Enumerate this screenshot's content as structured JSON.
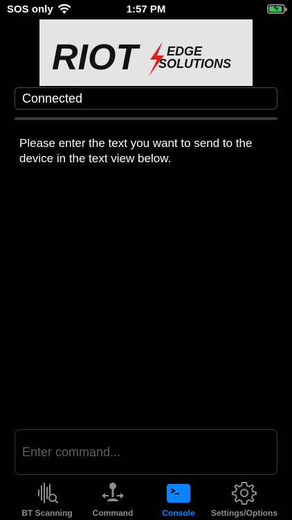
{
  "status_bar": {
    "carrier": "SOS only",
    "time": "1:57 PM",
    "battery_level": 0.9
  },
  "logo": {
    "brand": "RIOT",
    "tagline_line1": "EDGE",
    "tagline_line2": "SOLUTIONS"
  },
  "connection": {
    "status": "Connected"
  },
  "instructions": "Please enter the text you want to send to the device in the text view below.",
  "command_input": {
    "value": "",
    "placeholder": "Enter command..."
  },
  "tabs": [
    {
      "label": "BT Scanning",
      "icon": "waveform-search-icon",
      "active": false
    },
    {
      "label": "Command",
      "icon": "joystick-icon",
      "active": false
    },
    {
      "label": "Console",
      "icon": "terminal-icon",
      "active": true
    },
    {
      "label": "Settings/Options",
      "icon": "gear-icon",
      "active": false
    }
  ],
  "colors": {
    "accent": "#0a84ff",
    "inactive": "#8e8e93",
    "battery": "#34c759",
    "logo_red": "#e02020"
  }
}
